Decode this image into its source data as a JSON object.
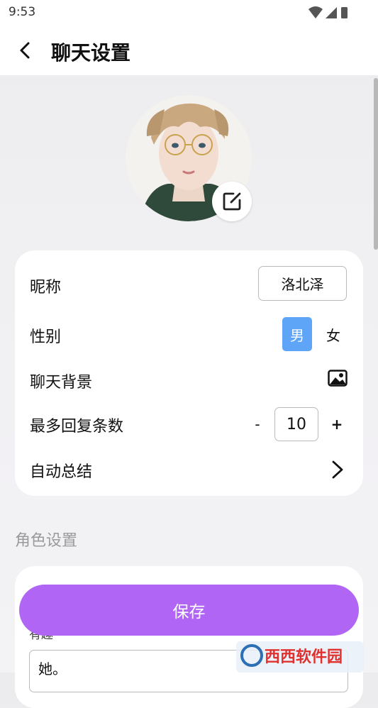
{
  "status": {
    "time": "9:53"
  },
  "header": {
    "title": "聊天设置"
  },
  "settings": {
    "nickname_label": "昵称",
    "nickname_value": "洛北泽",
    "gender_label": "性别",
    "gender_male": "男",
    "gender_female": "女",
    "gender_selected": "男",
    "background_label": "聊天背景",
    "max_reply_label": "最多回复条数",
    "max_reply_minus": "-",
    "max_reply_value": "10",
    "max_reply_plus": "+",
    "auto_summary_label": "自动总结"
  },
  "role": {
    "section_title": "角色设置",
    "hint": "有趣",
    "text_value": "她。"
  },
  "save_button": "保存",
  "watermark": "西西软件园",
  "colors": {
    "accent_purple": "#b165f5",
    "selected_blue": "#5ea4f7"
  }
}
